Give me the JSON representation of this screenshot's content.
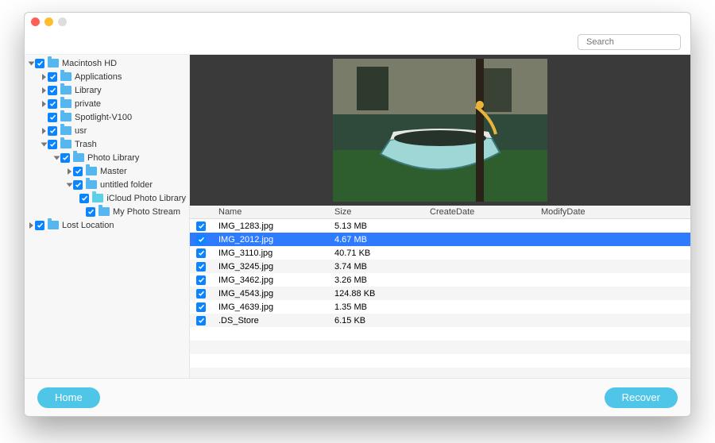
{
  "search": {
    "placeholder": "Search"
  },
  "sidebar": {
    "tree": [
      {
        "depth": 0,
        "disc": "open",
        "checked": true,
        "label": "Macintosh HD",
        "sel": false
      },
      {
        "depth": 1,
        "disc": "closed",
        "checked": true,
        "label": "Applications",
        "sel": false
      },
      {
        "depth": 1,
        "disc": "closed",
        "checked": true,
        "label": "Library",
        "sel": false
      },
      {
        "depth": 1,
        "disc": "closed",
        "checked": true,
        "label": "private",
        "sel": false
      },
      {
        "depth": 1,
        "disc": "none",
        "checked": true,
        "label": "Spotlight-V100",
        "sel": false
      },
      {
        "depth": 1,
        "disc": "closed",
        "checked": true,
        "label": "usr",
        "sel": false
      },
      {
        "depth": 1,
        "disc": "open",
        "checked": true,
        "label": "Trash",
        "sel": false
      },
      {
        "depth": 2,
        "disc": "open",
        "checked": true,
        "label": "Photo Library",
        "sel": false
      },
      {
        "depth": 3,
        "disc": "closed",
        "checked": true,
        "label": "Master",
        "sel": false
      },
      {
        "depth": 3,
        "disc": "open",
        "checked": true,
        "label": "untitled folder",
        "sel": false
      },
      {
        "depth": 4,
        "disc": "none",
        "checked": true,
        "label": "iCloud Photo Library",
        "sel": true
      },
      {
        "depth": 4,
        "disc": "none",
        "checked": true,
        "label": "My Photo Stream",
        "sel": false
      },
      {
        "depth": 0,
        "disc": "closed",
        "checked": true,
        "label": "Lost Location",
        "sel": false
      }
    ]
  },
  "table": {
    "columns": {
      "name": "Name",
      "size": "Size",
      "createDate": "CreateDate",
      "modifyDate": "ModifyDate"
    },
    "rows": [
      {
        "checked": true,
        "name": "IMG_1283.jpg",
        "size": "5.13 MB",
        "selected": false
      },
      {
        "checked": true,
        "name": "IMG_2012.jpg",
        "size": "4.67 MB",
        "selected": true
      },
      {
        "checked": true,
        "name": "IMG_3110.jpg",
        "size": "40.71 KB",
        "selected": false
      },
      {
        "checked": true,
        "name": "IMG_3245.jpg",
        "size": "3.74 MB",
        "selected": false
      },
      {
        "checked": true,
        "name": "IMG_3462.jpg",
        "size": "3.26 MB",
        "selected": false
      },
      {
        "checked": true,
        "name": "IMG_4543.jpg",
        "size": "124.88 KB",
        "selected": false
      },
      {
        "checked": true,
        "name": "IMG_4639.jpg",
        "size": "1.35 MB",
        "selected": false
      },
      {
        "checked": true,
        "name": ".DS_Store",
        "size": "6.15 KB",
        "selected": false
      }
    ]
  },
  "footer": {
    "home": "Home",
    "recover": "Recover"
  }
}
